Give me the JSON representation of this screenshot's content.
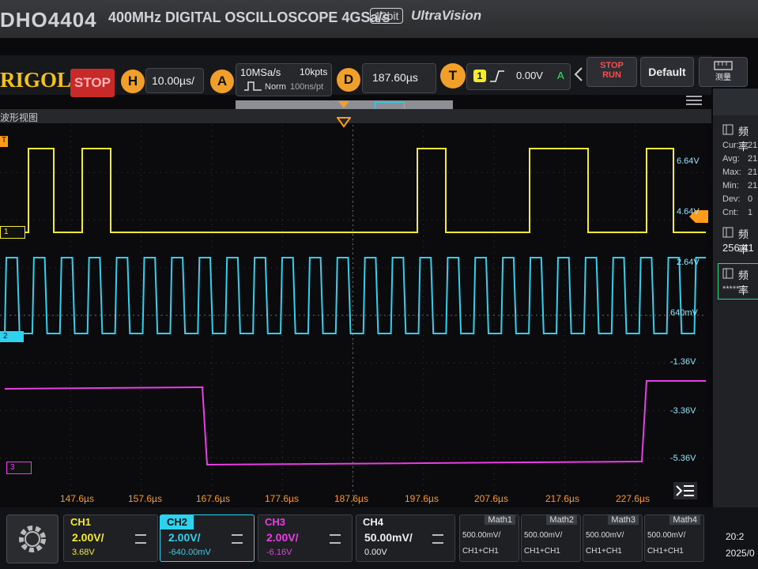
{
  "bezel": {
    "model": "DHO4404",
    "spec": "400MHz  DIGITAL OSCILLOSCOPE  4GSa/s",
    "bits": "12bit",
    "brand": "UltraVision"
  },
  "topbar": {
    "logo": "RIGOL",
    "run_state": "STOP",
    "horizontal": {
      "badge": "H",
      "value": "10.00µs/"
    },
    "acquire": {
      "badge": "A",
      "sample_rate": "10MSa/s",
      "points": "10kpts",
      "mode": "Norm",
      "interval": "100ns/pt"
    },
    "delay": {
      "badge": "D",
      "value": "187.60µs"
    },
    "trigger": {
      "badge": "T",
      "source": "1",
      "level": "0.00V",
      "status": "A"
    },
    "buttons": {
      "stop_run_top": "STOP",
      "stop_run_bottom": "RUN",
      "default": "Default",
      "measure": "测量"
    },
    "window_label": "波形视图"
  },
  "waveform": {
    "time_labels": [
      "147.6µs",
      "157.6µs",
      "167.6µs",
      "177.6µs",
      "187.6µs",
      "197.6µs",
      "207.6µs",
      "217.6µs",
      "227.6µs"
    ],
    "volt_labels": [
      "6.64V",
      "4.64V",
      "2.64V",
      "640mV",
      "-1.36V",
      "-3.36V",
      "-5.36V"
    ],
    "channel_markers": [
      "1",
      "2",
      "3"
    ],
    "trigger_marker": "T",
    "colors": {
      "ch1": "#f4ec2a",
      "ch2": "#2fd2ee",
      "ch3": "#e93de5",
      "accent": "#ff9a1a"
    }
  },
  "right_panel": {
    "title": "频率",
    "stats": [
      {
        "label": "Cur:",
        "value": "21"
      },
      {
        "label": "Avg:",
        "value": "21"
      },
      {
        "label": "Max:",
        "value": "21"
      },
      {
        "label": "Min:",
        "value": "21"
      },
      {
        "label": "Dev:",
        "value": "0"
      },
      {
        "label": "Cnt:",
        "value": "1"
      }
    ],
    "measure2_title": "频率",
    "measure2_value": "256.41",
    "measure3_title": "频率",
    "measure3_value": "*****"
  },
  "channels": [
    {
      "name": "CH1",
      "scale": "2.00V/",
      "offset": "3.68V"
    },
    {
      "name": "CH2",
      "scale": "2.00V/",
      "offset": "-640.00mV"
    },
    {
      "name": "CH3",
      "scale": "2.00V/",
      "offset": "-6.16V"
    },
    {
      "name": "CH4",
      "scale": "50.00mV/",
      "offset": "0.00V"
    }
  ],
  "math": [
    {
      "name": "Math1",
      "scale": "500.00mV/",
      "expr": "CH1+CH1"
    },
    {
      "name": "Math2",
      "scale": "500.00mV/",
      "expr": "CH1+CH1"
    },
    {
      "name": "Math3",
      "scale": "500.00mV/",
      "expr": "CH1+CH1"
    },
    {
      "name": "Math4",
      "scale": "500.00mV/",
      "expr": "CH1+CH1"
    }
  ],
  "clock": {
    "time": "20:2",
    "date": "2025/0"
  }
}
